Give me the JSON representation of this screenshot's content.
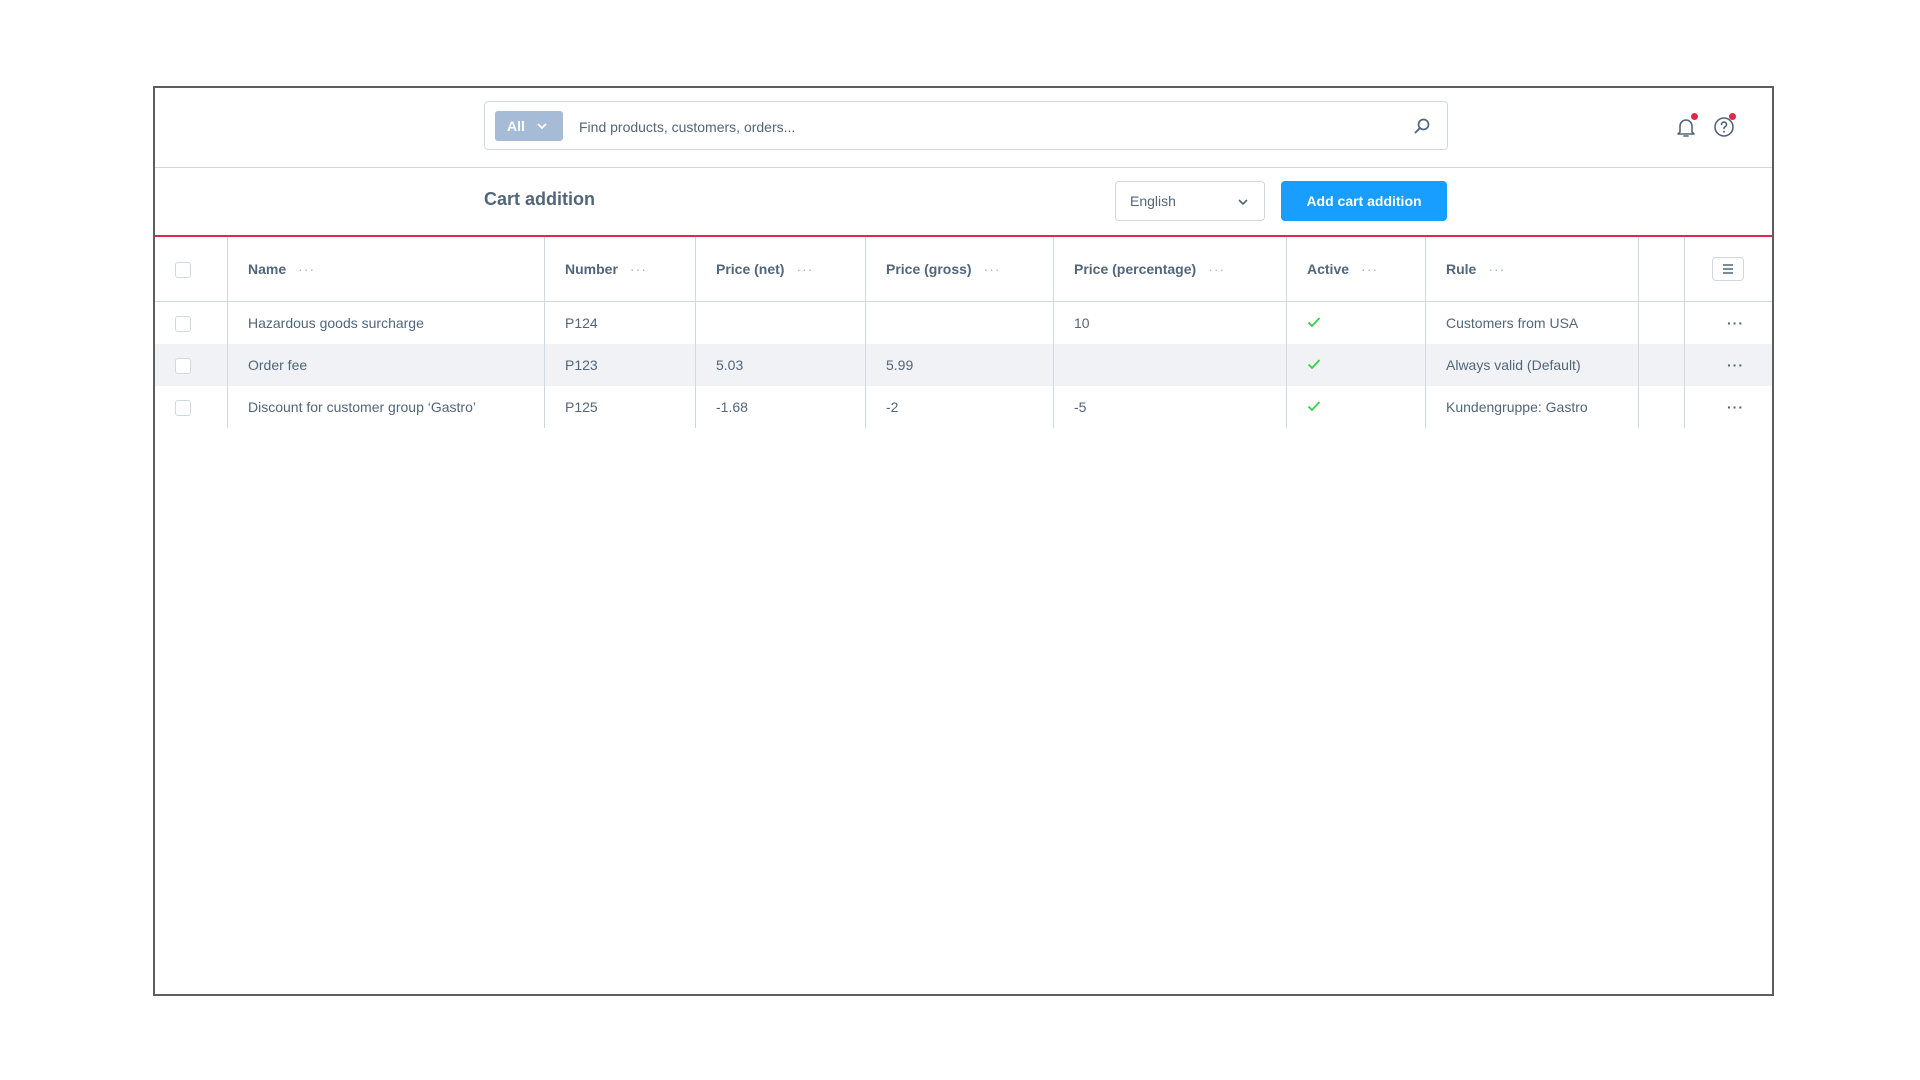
{
  "search": {
    "type_label": "All",
    "placeholder": "Find products, customers, orders..."
  },
  "header": {
    "title": "Cart addition",
    "language": "English",
    "add_button": "Add cart addition"
  },
  "table": {
    "columns": [
      "Name",
      "Number",
      "Price (net)",
      "Price (gross)",
      "Price (percentage)",
      "Active",
      "Rule"
    ],
    "column_menu": "···",
    "row_menu": "···",
    "rows": [
      {
        "name": "Hazardous goods surcharge",
        "number": "P124",
        "price_net": "",
        "price_gross": "",
        "price_percentage": "10",
        "active": true,
        "rule": "Customers from USA"
      },
      {
        "name": "Order fee",
        "number": "P123",
        "price_net": "5.03",
        "price_gross": "5.99",
        "price_percentage": "",
        "active": true,
        "rule": "Always valid (Default)"
      },
      {
        "name": "Discount for customer group ‘Gastro’",
        "number": "P125",
        "price_net": "-1.68",
        "price_gross": "-2",
        "price_percentage": "-5",
        "active": true,
        "rule": "Kundengruppe: Gastro"
      }
    ]
  },
  "colors": {
    "accent": "#189eff",
    "divider": "#de294c",
    "active_check": "#37d046",
    "text": "#52667a"
  },
  "icons": [
    "chevron-down-icon",
    "search-icon",
    "bell-icon",
    "help-icon",
    "check-icon",
    "list-settings-icon",
    "more-icon"
  ]
}
